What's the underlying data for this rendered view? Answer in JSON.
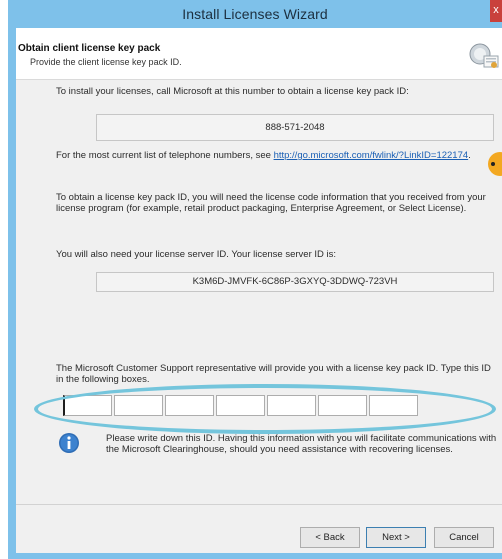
{
  "window": {
    "title": "Install Licenses Wizard",
    "close_glyph": "x"
  },
  "header": {
    "title": "Obtain client license key pack",
    "subtitle": "Provide the client license key pack ID.",
    "icon": "license-key-icon"
  },
  "body": {
    "intro": "To install your licenses, call Microsoft at this number to obtain a license key pack ID:",
    "phone_number": "888-571-2048",
    "numbers_text": "For the most current list of telephone numbers, see ",
    "numbers_link": "http://go.microsoft.com/fwlink/?LinkID=122174",
    "numbers_end": ".",
    "license_code_text": "To obtain a license key pack ID, you will need the license code information that you received from your license program (for example, retail product packaging, Enterprise Agreement, or Select License).",
    "server_id_label": "You will also need your license server ID. Your license server ID is:",
    "server_id": "K3M6D-JMVFK-6C86P-3GXYQ-3DDWQ-723VH",
    "instructions": "The Microsoft Customer Support representative will provide you with a license key pack ID. Type this ID in the following boxes.",
    "key_boxes": [
      "",
      "",
      "",
      "",
      "",
      "",
      ""
    ],
    "note": "Please write down this ID. Having this information with you will facilitate communications with the Microsoft Clearinghouse, should you need assistance with recovering licenses.",
    "info_icon": "info-icon"
  },
  "buttons": {
    "back": "< Back",
    "next": "Next >",
    "cancel": "Cancel"
  },
  "colors": {
    "frame": "#7ec1ea",
    "highlight": "#74c5dc",
    "link": "#1a5fb4",
    "badge": "#f3a821"
  }
}
